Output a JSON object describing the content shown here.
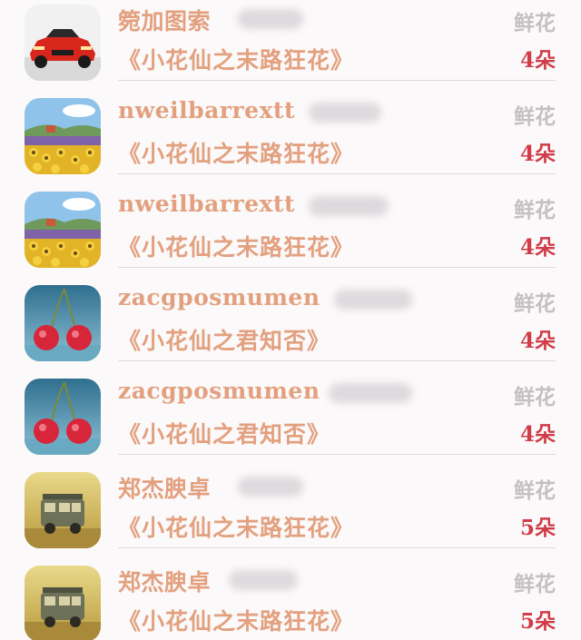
{
  "rows": [
    {
      "name": "箢加图索",
      "gift": "鲜花",
      "song": "《小花仙之末路狂花》",
      "count": "4朵",
      "avatar": "red-car-icon"
    },
    {
      "name": "nweilbarrextt",
      "gift": "鲜花",
      "song": "《小花仙之末路狂花》",
      "count": "4朵",
      "avatar": "sunflower-field-icon"
    },
    {
      "name": "nweilbarrextt",
      "gift": "鲜花",
      "song": "《小花仙之末路狂花》",
      "count": "4朵",
      "avatar": "sunflower-field-icon"
    },
    {
      "name": "zacgposmumen",
      "gift": "鲜花",
      "song": "《小花仙之君知否》",
      "count": "4朵",
      "avatar": "cherries-icon"
    },
    {
      "name": "zacgposmumen",
      "gift": "鲜花",
      "song": "《小花仙之君知否》",
      "count": "4朵",
      "avatar": "cherries-icon"
    },
    {
      "name": "郑杰腴卓",
      "gift": "鲜花",
      "song": "《小花仙之末路狂花》",
      "count": "5朵",
      "avatar": "toy-truck-icon"
    },
    {
      "name": "郑杰腴卓",
      "gift": "鲜花",
      "song": "《小花仙之末路狂花》",
      "count": "5朵",
      "avatar": "toy-truck-icon"
    }
  ],
  "colors": {
    "name": "#e3a07f",
    "gift": "#c3c0c1",
    "count": "#d03c48",
    "background": "#fbf9f9"
  }
}
